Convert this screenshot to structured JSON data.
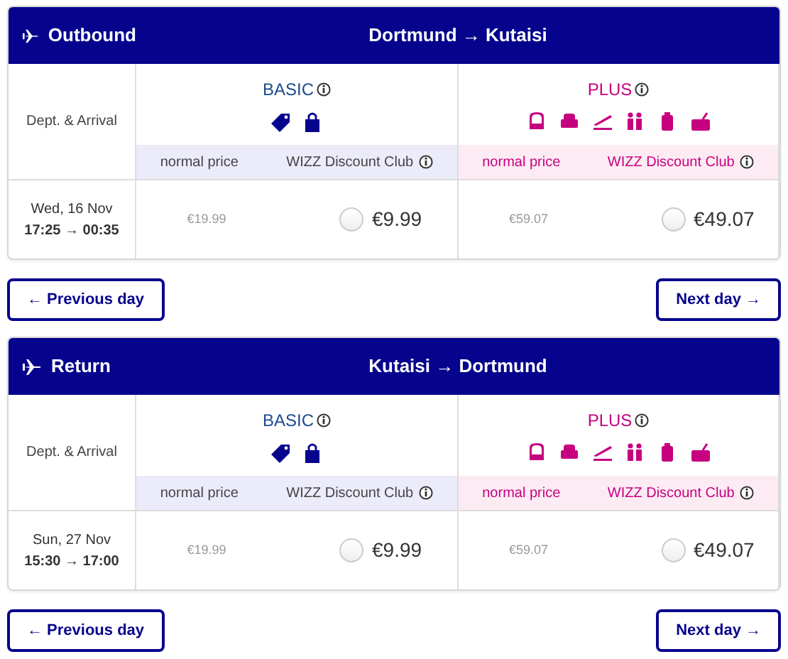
{
  "flights": [
    {
      "direction": "Outbound",
      "route": "Dortmund → Kutaisi",
      "time_label": "Dept. & Arrival",
      "date": "Wed, 16 Nov",
      "times": "17:25 → 00:35",
      "fares": [
        {
          "kind": "basic",
          "name": "BASIC",
          "normal_label": "normal price",
          "club_label": "WIZZ Discount Club",
          "normal_price": "€19.99",
          "club_price": "€9.99",
          "selected": false
        },
        {
          "kind": "plus",
          "name": "PLUS",
          "normal_label": "normal price",
          "club_label": "WIZZ Discount Club",
          "normal_price": "€59.07",
          "club_price": "€49.07",
          "selected": false
        }
      ],
      "buttons": [
        {
          "label": "← Previous day"
        },
        {
          "label": "Next day →"
        }
      ]
    },
    {
      "direction": "Return",
      "route": "Kutaisi → Dortmund",
      "time_label": "Dept. & Arrival",
      "date": "Sun, 27 Nov",
      "times": "15:30 → 17:00",
      "fares": [
        {
          "kind": "basic",
          "name": "BASIC",
          "normal_label": "normal price",
          "club_label": "WIZZ Discount Club",
          "normal_price": "€19.99",
          "club_price": "€9.99",
          "selected": false
        },
        {
          "kind": "plus",
          "name": "PLUS",
          "normal_label": "normal price",
          "club_label": "WIZZ Discount Club",
          "normal_price": "€59.07",
          "club_price": "€49.07",
          "selected": false
        }
      ],
      "buttons": [
        {
          "label": "← Previous day"
        },
        {
          "label": "Next day →"
        }
      ]
    }
  ]
}
